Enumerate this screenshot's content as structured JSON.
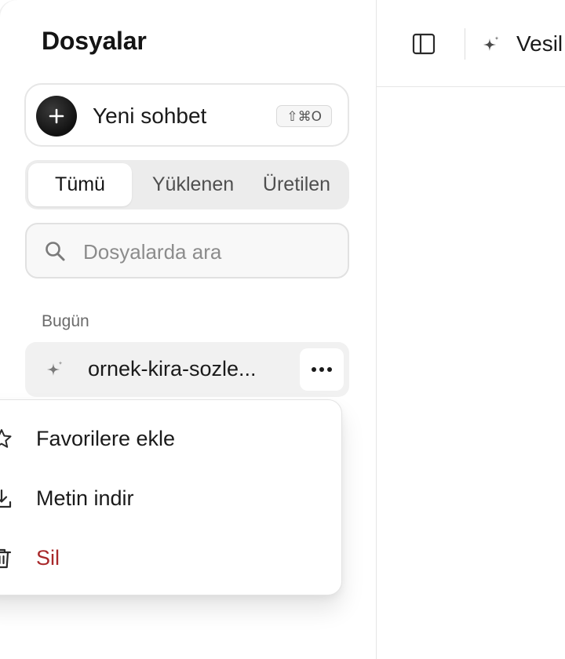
{
  "sidebar": {
    "title": "Dosyalar",
    "new_chat": {
      "label": "Yeni sohbet",
      "shortcut": "⇧⌘O"
    },
    "tabs": [
      {
        "label": "Tümü",
        "active": true
      },
      {
        "label": "Yüklenen",
        "active": false
      },
      {
        "label": "Üretilen",
        "active": false
      }
    ],
    "search": {
      "placeholder": "Dosyalarda ara",
      "value": ""
    },
    "sections": [
      {
        "label": "Bugün",
        "items": [
          {
            "name": "ornek-kira-sozle...",
            "icon": "sparkle-icon"
          }
        ]
      }
    ]
  },
  "context_menu": {
    "items": [
      {
        "label": "Favorilere ekle",
        "icon": "star-icon"
      },
      {
        "label": "Metin indir",
        "icon": "download-icon"
      },
      {
        "label": "Sil",
        "icon": "trash-icon",
        "color": "#a8282a"
      }
    ]
  },
  "main": {
    "doc_title": "Vesil"
  },
  "colors": {
    "danger": "#a8282a",
    "tab_bg": "#ececec",
    "selected_item_bg": "#f1f1f1"
  }
}
